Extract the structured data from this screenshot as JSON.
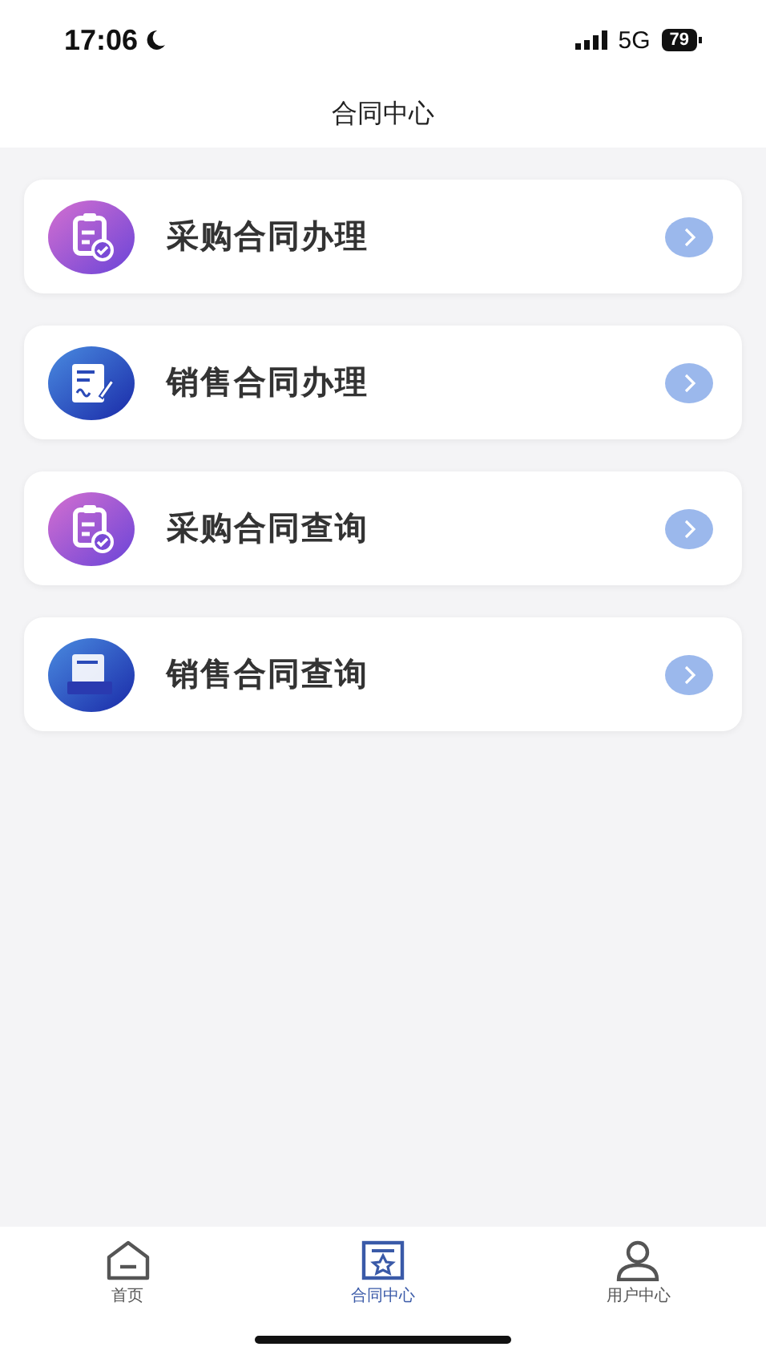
{
  "status_bar": {
    "time": "17:06",
    "network": "5G",
    "battery": "79"
  },
  "header": {
    "title": "合同中心"
  },
  "menu_items": [
    {
      "label": "采购合同办理",
      "kind": "clipboard"
    },
    {
      "label": "销售合同办理",
      "kind": "sign"
    },
    {
      "label": "采购合同查询",
      "kind": "clipboard"
    },
    {
      "label": "销售合同查询",
      "kind": "doc"
    }
  ],
  "tab_bar": [
    {
      "label": "首页",
      "kind": "home",
      "selected": false
    },
    {
      "label": "合同中心",
      "kind": "contract",
      "selected": true
    },
    {
      "label": "用户中心",
      "kind": "user",
      "selected": false
    }
  ]
}
